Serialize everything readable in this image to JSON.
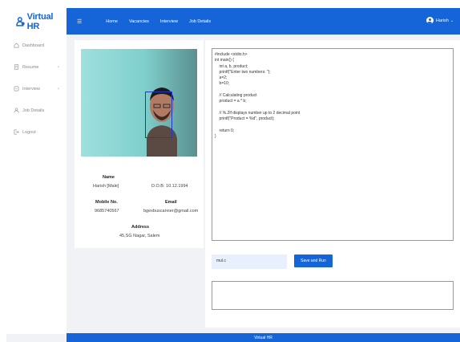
{
  "app": {
    "logo_text": "Virtual HR",
    "footer_text": "Virtual HR"
  },
  "nav": {
    "menu_icon": "menu-icon",
    "links": [
      "Home",
      "Vacancies",
      "Interview",
      "Job Details"
    ],
    "user_name": "Harish",
    "user_icon": "user-circle-icon"
  },
  "sidebar": {
    "items": [
      {
        "label": "Dashboard",
        "icon": "home-icon",
        "has_chevron": false
      },
      {
        "label": "Resume",
        "icon": "resume-icon",
        "has_chevron": true
      },
      {
        "label": "Interview",
        "icon": "interview-icon",
        "has_chevron": true
      },
      {
        "label": "Job Details",
        "icon": "job-icon",
        "has_chevron": false
      },
      {
        "label": "Logout",
        "icon": "logout-icon",
        "has_chevron": false
      }
    ]
  },
  "profile": {
    "name_label": "Name",
    "name_value": "Harish [Male]",
    "dob_value": "D.O.B: 10.12.1994",
    "mobile_label": "Mobile No.",
    "mobile_value": "9685740567",
    "email_label": "Email",
    "email_value": "bgexbuscanner@gmail.com",
    "address_label": "Address",
    "address_value": "45,SG Nagar, Salem"
  },
  "code": {
    "lines": [
      "#include <stdio.h>",
      "int main() {",
      "    int a, b, product;",
      "    printf(\"Enter two numbers: \");",
      "    a=2;",
      "    b=10;",
      "",
      "    // Calculating product",
      "    product = a * b;",
      "",
      "    // %.2lf displays number up to 2 decimal point",
      "    printf(\"Product = %d\", product);",
      "",
      "    return 0;",
      "}"
    ],
    "input_value": "mul.c",
    "run_label": "Save and Run"
  },
  "colors": {
    "primary": "#1565d8",
    "background": "#f1f2f6",
    "input_bg": "#e8f0fe"
  }
}
